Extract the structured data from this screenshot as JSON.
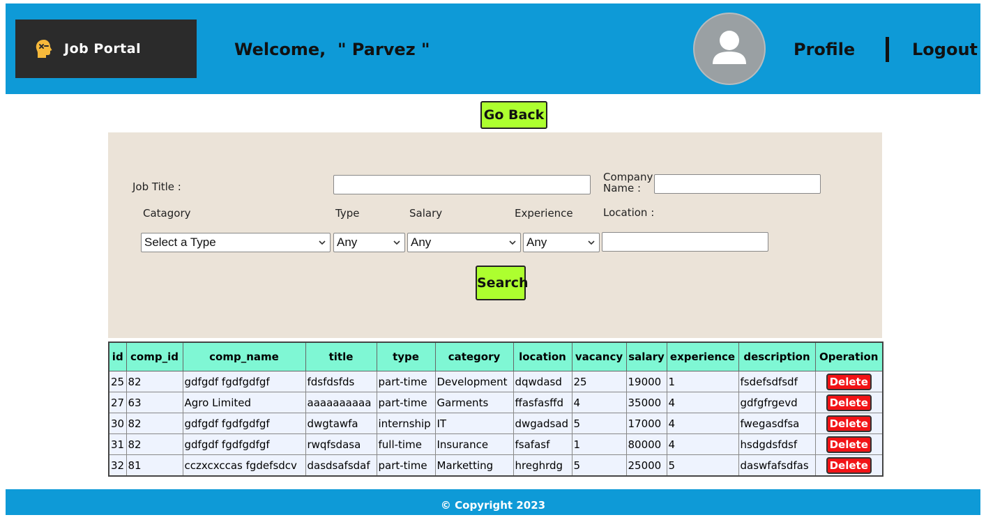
{
  "header": {
    "logo_text": "Job Portal",
    "welcome_text": "Welcome,  \" Parvez \"",
    "profile_label": "Profile",
    "logout_label": "Logout"
  },
  "go_back_label": "Go Back",
  "search_form": {
    "job_title_label": "Job Title :",
    "job_title_value": "",
    "company_name_label_line1": "Company",
    "company_name_label_line2": "Name :",
    "company_name_value": "",
    "category_label": "Catagory",
    "category_selected": "Select a Type",
    "type_label": "Type",
    "type_selected": "Any",
    "salary_label": "Salary",
    "salary_selected": "Any",
    "experience_label": "Experience",
    "experience_selected": "Any",
    "location_label": "Location :",
    "location_value": "",
    "search_label": "Search"
  },
  "table": {
    "columns": [
      "id",
      "comp_id",
      "comp_name",
      "title",
      "type",
      "category",
      "location",
      "vacancy",
      "salary",
      "experience",
      "description",
      "Operation"
    ],
    "delete_label": "Delete",
    "rows": [
      [
        "25",
        "82",
        "gdfgdf fgdfgdfgf",
        "fdsfdsfds",
        "part-time",
        "Development",
        "dqwdasd",
        "25",
        "19000",
        "1",
        "fsdefsdfsdf"
      ],
      [
        "27",
        "63",
        "Agro Limited",
        "aaaaaaaaaa",
        "part-time",
        "Garments",
        "ffasfasffd",
        "4",
        "35000",
        "4",
        "gdfgfrgevd"
      ],
      [
        "30",
        "82",
        "gdfgdf fgdfgdfgf",
        "dwgtawfa",
        "internship",
        "IT",
        "dwgadsad",
        "5",
        "17000",
        "4",
        "fwegasdfsa"
      ],
      [
        "31",
        "82",
        "gdfgdf fgdfgdfgf",
        "rwqfsdasa",
        "full-time",
        "Insurance",
        "fsafasf",
        "1",
        "80000",
        "4",
        "hsdgdsfdsf"
      ],
      [
        "32",
        "81",
        "cczxcxccas fgdefsdcv",
        "dasdsafsdaf",
        "part-time",
        "Marketting",
        "hreghrdg",
        "5",
        "25000",
        "5",
        "daswfafsdfas"
      ]
    ]
  },
  "footer_text": "© Copyright 2023",
  "colors": {
    "header_bg": "#0e9ad7",
    "button_green": "#adff2f",
    "panel_bg": "#ebe3d8",
    "table_header_bg": "#7ff7d4",
    "table_cell_bg": "#eef3fe",
    "delete_red": "#f21316"
  }
}
